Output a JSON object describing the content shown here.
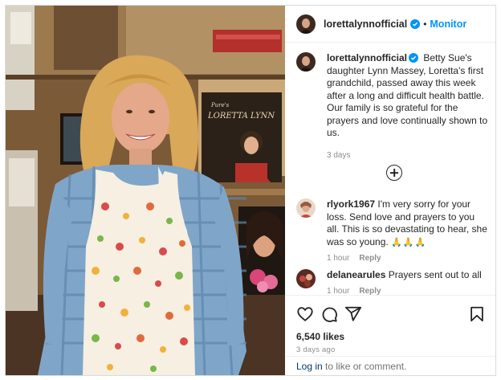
{
  "header": {
    "username": "lorettalynnofficial",
    "separator": "•",
    "action": "Monitor"
  },
  "caption": {
    "username": "lorettalynnofficial",
    "text": "Betty Sue's daughter Lynn Massey, Loretta's first grandchild, passed away this week after a long and difficult health battle. Our family is so grateful for the prayers and love continually shown to us.",
    "time": "3 days"
  },
  "comments": [
    {
      "username": "rlyork1967",
      "text": "I'm very sorry for your loss. Send love and prayers to you all. This is so devastating to hear, she was so young.",
      "emoji": "🙏🙏🙏",
      "time": "1 hour",
      "reply": "Reply"
    },
    {
      "username": "delanearules",
      "text": "Prayers sent out to all",
      "time": "1 hour",
      "reply": "Reply"
    }
  ],
  "footer": {
    "likes": "6,540 likes",
    "posted": "3 days ago",
    "login_link": "Log in",
    "login_suffix": " to like or comment."
  },
  "photo": {
    "album_brand": "Pure's",
    "album_title": "LORETTA LYNN"
  },
  "colors": {
    "link_blue": "#0095f6",
    "verified_blue": "#0095f6",
    "muted": "#8e8e8e",
    "text": "#262626"
  },
  "icons": [
    "heart-icon",
    "comment-icon",
    "share-icon",
    "bookmark-icon",
    "verified-icon",
    "more-comments-icon"
  ]
}
